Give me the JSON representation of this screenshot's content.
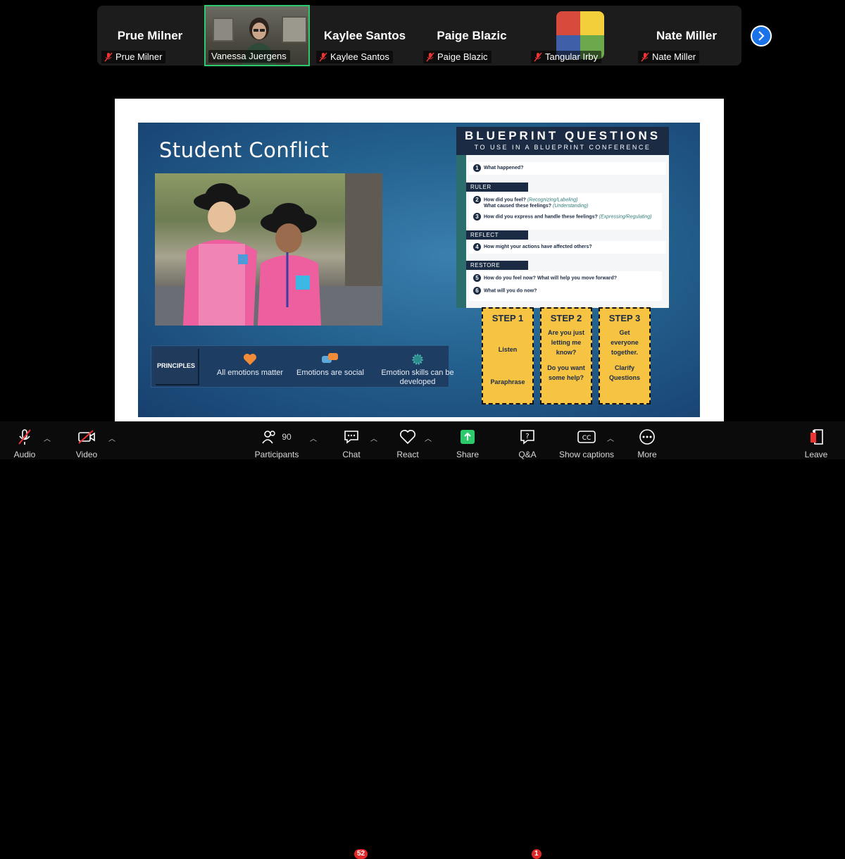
{
  "participants": [
    {
      "display_name": "Prue Milner",
      "name_tag": "Prue Milner",
      "muted": true
    },
    {
      "display_name": "",
      "name_tag": "Vanessa Juergens",
      "muted": false,
      "active_speaker": true
    },
    {
      "display_name": "Kaylee Santos",
      "name_tag": "Kaylee Santos",
      "muted": true
    },
    {
      "display_name": "Paige Blazic",
      "name_tag": "Paige Blazic",
      "muted": true
    },
    {
      "display_name": "",
      "name_tag": "Tangular Irby",
      "muted": true
    },
    {
      "display_name": "Nate Miller",
      "name_tag": "Nate Miller",
      "muted": true
    }
  ],
  "colors": {
    "active_border": "#2dc96a",
    "accent_blue": "#1a73e8",
    "badge_red": "#e02828",
    "step_yellow": "#f6c343"
  },
  "slide": {
    "title": "Student Conflict",
    "principles": {
      "label": "PRINCIPLES",
      "items": [
        "All emotions matter",
        "Emotions are social",
        "Emotion skills can be developed"
      ]
    },
    "blueprint": {
      "title": "BLUEPRINT QUESTIONS",
      "subtitle": "TO USE IN A BLUEPRINT CONFERENCE",
      "q1": "What happened?",
      "ruler_label": "RULER",
      "q2a": "How did you feel?",
      "q2a_note": "(Recognizing/Labeling)",
      "q2b": "What caused these feelings?",
      "q2b_note": "(Understanding)",
      "q3": "How did you express and handle these feelings?",
      "q3_note": "(Expressing/Regulating)",
      "reflect_label": "REFLECT",
      "q4": "How might your actions have affected others?",
      "restore_label": "RESTORE",
      "q5": "How do you feel now? What will help you move forward?",
      "q6": "What will you do now?"
    },
    "steps": [
      {
        "title": "STEP 1",
        "line1": "Listen",
        "line2": "Paraphrase"
      },
      {
        "title": "STEP 2",
        "line1": "Are you just letting me know?",
        "line2": "Do you want some help?"
      },
      {
        "title": "STEP 3",
        "line1": "Get everyone together.",
        "line2": "Clarify Questions"
      }
    ]
  },
  "toolbar": {
    "audio": "Audio",
    "video": "Video",
    "participants": "Participants",
    "participants_count": "90",
    "chat": "Chat",
    "chat_badge": "52",
    "react": "React",
    "share": "Share",
    "qa": "Q&A",
    "qa_badge": "1",
    "captions": "Show captions",
    "more": "More",
    "leave": "Leave"
  }
}
